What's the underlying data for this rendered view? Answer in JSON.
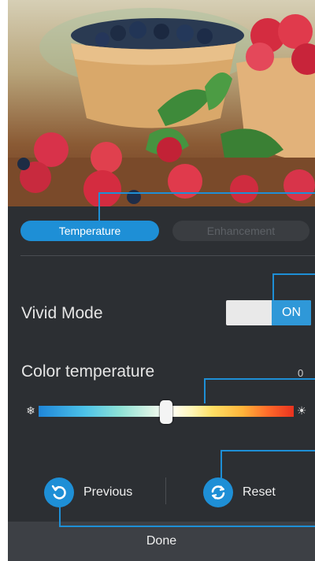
{
  "tabs": {
    "temperature": "Temperature",
    "enhancement": "Enhancement"
  },
  "vivid_mode": {
    "label": "Vivid Mode",
    "toggle_state": "ON"
  },
  "color_temperature": {
    "label": "Color temperature",
    "value": "0",
    "slider_position": 0.5,
    "cool_icon": "snowflake-icon",
    "warm_icon": "sun-icon"
  },
  "actions": {
    "previous": "Previous",
    "reset": "Reset",
    "done": "Done"
  },
  "colors": {
    "accent": "#1e8fd6",
    "panel": "#2c2f33",
    "toggle_on": "#2f98d8"
  }
}
